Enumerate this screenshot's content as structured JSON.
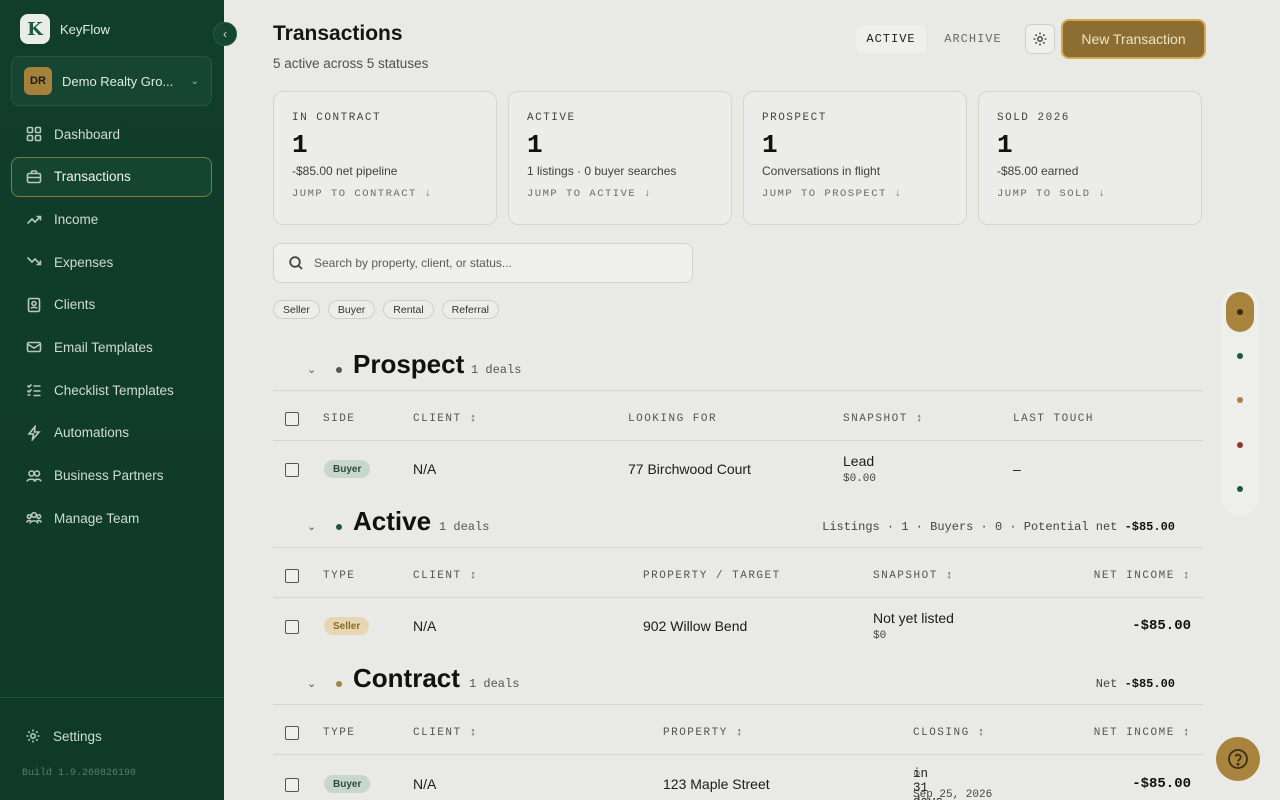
{
  "sidebar": {
    "brand": "KeyFlow",
    "logo_letter": "K",
    "org": {
      "initials": "DR",
      "name": "Demo Realty Gro..."
    },
    "nav": [
      {
        "label": "Dashboard",
        "icon": "dashboard-icon"
      },
      {
        "label": "Transactions",
        "icon": "briefcase-icon",
        "active": true
      },
      {
        "label": "Income",
        "icon": "trending-up-icon"
      },
      {
        "label": "Expenses",
        "icon": "trending-down-icon"
      },
      {
        "label": "Clients",
        "icon": "contacts-icon"
      },
      {
        "label": "Email Templates",
        "icon": "mail-icon"
      },
      {
        "label": "Checklist Templates",
        "icon": "checklist-icon"
      },
      {
        "label": "Automations",
        "icon": "lightning-icon"
      },
      {
        "label": "Business Partners",
        "icon": "partners-icon"
      },
      {
        "label": "Manage Team",
        "icon": "team-icon"
      }
    ],
    "settings_label": "Settings",
    "build": "Build 1.9.260826190"
  },
  "header": {
    "title": "Transactions",
    "subtitle": "5 active across 5 statuses",
    "tab_active": "ACTIVE",
    "tab_archive": "ARCHIVE",
    "new_button": "New Transaction"
  },
  "cards": [
    {
      "label": "IN CONTRACT",
      "count": "1",
      "desc": "-$85.00 net pipeline",
      "link": "JUMP TO CONTRACT ↓"
    },
    {
      "label": "ACTIVE",
      "count": "1",
      "desc": "1 listings · 0 buyer searches",
      "link": "JUMP TO ACTIVE ↓"
    },
    {
      "label": "PROSPECT",
      "count": "1",
      "desc": "Conversations in flight",
      "link": "JUMP TO PROSPECT ↓"
    },
    {
      "label": "SOLD 2026",
      "count": "1",
      "desc": "-$85.00 earned",
      "link": "JUMP TO SOLD ↓"
    }
  ],
  "search": {
    "placeholder": "Search by property, client, or status..."
  },
  "filters": [
    "Seller",
    "Buyer",
    "Rental",
    "Referral"
  ],
  "sections": {
    "prospect": {
      "title": "Prospect",
      "count": "1 deals",
      "dot_color": "#555555",
      "columns": [
        "SIDE",
        "CLIENT ↕",
        "LOOKING FOR",
        "SNAPSHOT ↕",
        "LAST TOUCH"
      ],
      "row": {
        "side": "Buyer",
        "client": "N/A",
        "looking_for": "77 Birchwood Court",
        "snapshot": "Lead",
        "snapshot_sub": "$0.00",
        "last_touch": "–"
      }
    },
    "active": {
      "title": "Active",
      "count": "1 deals",
      "dot_color": "#1c5a3c",
      "summary_prefix": "Listings · 1 · Buyers · 0 · Potential net",
      "summary_value": "-$85.00",
      "columns": [
        "TYPE",
        "CLIENT ↕",
        "PROPERTY / TARGET",
        "SNAPSHOT ↕",
        "NET INCOME ↕"
      ],
      "row": {
        "type": "Seller",
        "client": "N/A",
        "property": "902 Willow Bend",
        "snapshot": "Not yet listed",
        "snapshot_sub": "$0",
        "net": "-$85.00"
      }
    },
    "contract": {
      "title": "Contract",
      "count": "1 deals",
      "dot_color": "#a8843e",
      "summary_prefix": "Net",
      "summary_value": "-$85.00",
      "columns": [
        "TYPE",
        "CLIENT ↕",
        "PROPERTY ↕",
        "CLOSING ↕",
        "NET INCOME ↕"
      ],
      "row": {
        "type": "Buyer",
        "client": "N/A",
        "property": "123 Maple Street",
        "closing": "in 31 days",
        "closing_sub": "Sep 25, 2026",
        "net": "-$85.00"
      }
    }
  },
  "rail": [
    {
      "color": "#3a2a12",
      "active": true
    },
    {
      "color": "#1c5a3c"
    },
    {
      "color": "#a8843e"
    },
    {
      "color": "#8a3a2a"
    },
    {
      "color": "#1c5a3c"
    }
  ],
  "colors": {
    "brand_green": "#113d2b",
    "accent_gold": "#a8843e"
  }
}
